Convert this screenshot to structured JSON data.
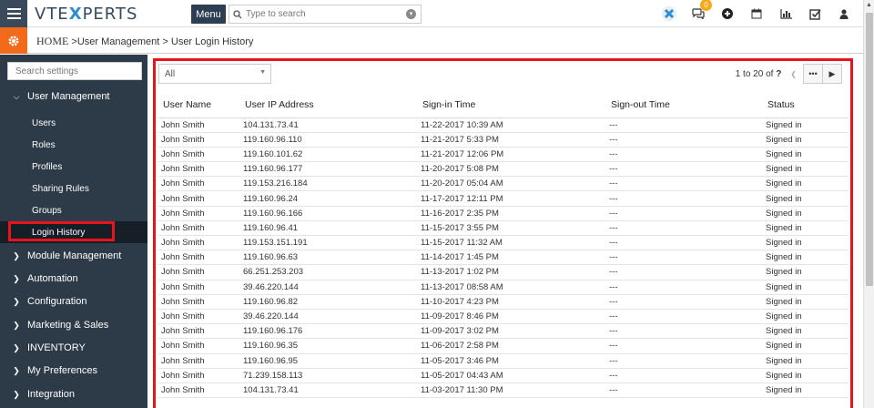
{
  "header": {
    "logo_pre": "VTE",
    "logo_x": "X",
    "logo_post": "PERTS",
    "menu_label": "Menu",
    "search_placeholder": "Type to search",
    "notification_count": "0",
    "icons": [
      "x-app-icon",
      "chat-icon",
      "plus-icon",
      "calendar-icon",
      "chart-icon",
      "task-icon",
      "user-icon"
    ]
  },
  "breadcrumb": {
    "home": "HOME",
    "sep1": " >",
    "item1": "User Management",
    "sep2": " > ",
    "item2": "User Login History"
  },
  "sidebar": {
    "search_placeholder": "Search settings",
    "sections": [
      {
        "label": "User Management",
        "expanded": true
      },
      {
        "label": "Module Management"
      },
      {
        "label": "Automation"
      },
      {
        "label": "Configuration"
      },
      {
        "label": "Marketing & Sales"
      },
      {
        "label": "INVENTORY"
      },
      {
        "label": "My Preferences"
      },
      {
        "label": "Integration"
      }
    ],
    "sub_items": [
      "Users",
      "Roles",
      "Profiles",
      "Sharing Rules",
      "Groups",
      "Login History"
    ],
    "active": "Login History"
  },
  "toolbar": {
    "filter_value": "All",
    "pager_text": "1 to 20  of",
    "pager_total": "?"
  },
  "table": {
    "columns": [
      "User Name",
      "User IP Address",
      "Sign-in Time",
      "Sign-out Time",
      "Status"
    ],
    "rows": [
      [
        "John Smith",
        "104.131.73.41",
        "11-22-2017 10:39 AM",
        "---",
        "Signed in"
      ],
      [
        "John Smith",
        "119.160.96.110",
        "11-21-2017 5:33 PM",
        "---",
        "Signed in"
      ],
      [
        "John Smith",
        "119.160.101.62",
        "11-21-2017 12:06 PM",
        "---",
        "Signed in"
      ],
      [
        "John Smith",
        "119.160.96.177",
        "11-20-2017 5:08 PM",
        "---",
        "Signed in"
      ],
      [
        "John Smith",
        "119.153.216.184",
        "11-20-2017 05:04 AM",
        "---",
        "Signed in"
      ],
      [
        "John Smith",
        "119.160.96.24",
        "11-17-2017 12:11 PM",
        "---",
        "Signed in"
      ],
      [
        "John Smith",
        "119.160.96.166",
        "11-16-2017 2:35 PM",
        "---",
        "Signed in"
      ],
      [
        "John Smith",
        "119.160.96.41",
        "11-15-2017 3:55 PM",
        "---",
        "Signed in"
      ],
      [
        "John Smith",
        "119.153.151.191",
        "11-15-2017 11:32 AM",
        "---",
        "Signed in"
      ],
      [
        "John Smith",
        "119.160.96.63",
        "11-14-2017 1:45 PM",
        "---",
        "Signed in"
      ],
      [
        "John Smith",
        "66.251.253.203",
        "11-13-2017 1:02 PM",
        "---",
        "Signed in"
      ],
      [
        "John Smith",
        "39.46.220.144",
        "11-13-2017 08:58 AM",
        "---",
        "Signed in"
      ],
      [
        "John Smith",
        "119.160.96.82",
        "11-10-2017 4:23 PM",
        "---",
        "Signed in"
      ],
      [
        "John Smith",
        "39.46.220.144",
        "11-09-2017 8:46 PM",
        "---",
        "Signed in"
      ],
      [
        "John Smith",
        "119.160.96.176",
        "11-09-2017 3:02 PM",
        "---",
        "Signed in"
      ],
      [
        "John Smith",
        "119.160.96.35",
        "11-06-2017 2:58 PM",
        "---",
        "Signed in"
      ],
      [
        "John Smith",
        "119.160.96.95",
        "11-05-2017 3:46 PM",
        "---",
        "Signed in"
      ],
      [
        "John Smith",
        "71.239.158.113",
        "11-05-2017 04:43 AM",
        "---",
        "Signed in"
      ],
      [
        "John Smith",
        "104.131.73.41",
        "11-03-2017 11:30 PM",
        "---",
        "Signed in"
      ]
    ]
  },
  "colors": {
    "accent_orange": "#f26b1d",
    "sidebar_bg": "#2d3a48",
    "highlight_red": "#e8141b",
    "brand_blue": "#2e8ccf"
  }
}
